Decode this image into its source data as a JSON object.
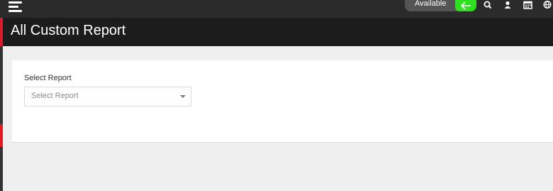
{
  "topbar": {
    "menu_icon": "hamburger-icon",
    "status_label": "Available",
    "status_color": "#2fe020",
    "icons": [
      "search-icon",
      "user-icon",
      "calendar-icon",
      "globe-icon"
    ]
  },
  "header": {
    "title": "All Custom Report",
    "accent_color": "#d81b2a"
  },
  "report_selector": {
    "label": "Select Report",
    "selected_value": "Select Report"
  }
}
